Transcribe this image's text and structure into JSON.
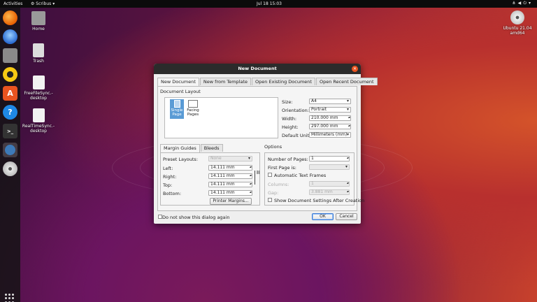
{
  "topbar": {
    "activities": "Activities",
    "app": "Scribus",
    "clock": "Jul 18  15:03"
  },
  "dock": {
    "items": [
      {
        "name": "firefox",
        "color": "#e66000"
      },
      {
        "name": "thunderbird",
        "color": "#2a6bd1"
      },
      {
        "name": "files",
        "color": "#8a8a8a"
      },
      {
        "name": "rhythmbox",
        "color": "#f6c913"
      },
      {
        "name": "software",
        "color": "#e95420"
      },
      {
        "name": "help",
        "color": "#1e88e5"
      },
      {
        "name": "terminal",
        "color": "#333333"
      },
      {
        "name": "scribus",
        "color": "#3d7ab8"
      },
      {
        "name": "dvd",
        "color": "#d0d0d0"
      }
    ]
  },
  "desktop": {
    "home": "Home",
    "trash": "Trash",
    "ffs": "FreeFileSync.-desktop",
    "rts": "RealTimeSync.-desktop",
    "disk": "Ubuntu 21.04 amd64"
  },
  "dialog": {
    "title": "New Document",
    "tabs": [
      "New Document",
      "New from Template",
      "Open Existing Document",
      "Open Recent Document"
    ],
    "layout": {
      "heading": "Document Layout",
      "single": "Single Page",
      "facing": "Facing Pages",
      "size_label": "Size:",
      "size": "A4",
      "orientation_label": "Orientation:",
      "orientation": "Portrait",
      "width_label": "Width:",
      "width": "210.000 mm",
      "height_label": "Height:",
      "height": "297.000 mm",
      "unit_label": "Default Unit:",
      "unit": "Millimeters (mm)"
    },
    "margins": {
      "tabs": [
        "Margin Guides",
        "Bleeds"
      ],
      "preset_label": "Preset Layouts:",
      "preset": "None",
      "left_label": "Left:",
      "left": "14.111 mm",
      "right_label": "Right:",
      "right": "14.111 mm",
      "top_label": "Top:",
      "top": "14.111 mm",
      "bottom_label": "Bottom:",
      "bottom": "14.111 mm",
      "printer_button": "Printer Margins..."
    },
    "options": {
      "heading": "Options",
      "pages_label": "Number of Pages:",
      "pages": "1",
      "first_label": "First Page is:",
      "first": "",
      "auto_frames": "Automatic Text Frames",
      "columns_label": "Columns:",
      "columns": "1",
      "gap_label": "Gap:",
      "gap": "3.881 mm",
      "show_after": "Show Document Settings After Creation"
    },
    "footer": {
      "dont_show": "Do not show this dialog again",
      "ok": "OK",
      "cancel": "Cancel"
    }
  },
  "colors": {
    "accent": "#e95420",
    "selection": "#5a9bd5"
  }
}
